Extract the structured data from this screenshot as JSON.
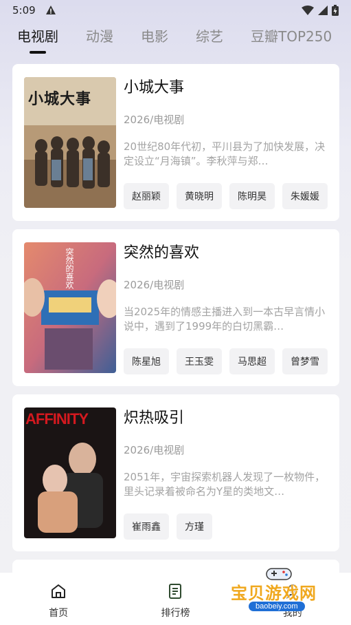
{
  "status_bar": {
    "time": "5:09"
  },
  "tabs": [
    {
      "label": "电视剧",
      "active": true
    },
    {
      "label": "动漫",
      "active": false
    },
    {
      "label": "电影",
      "active": false
    },
    {
      "label": "综艺",
      "active": false
    },
    {
      "label": "豆瓣TOP250",
      "active": false
    }
  ],
  "items": [
    {
      "title": "小城大事",
      "poster_text": "小城大事",
      "meta": "2026/电视剧",
      "desc": "20世纪80年代初，平川县为了加快发展，决定设立“月海镇”。李秋萍与郑…",
      "actors": [
        "赵丽颖",
        "黄晓明",
        "陈明昊",
        "朱媛媛"
      ]
    },
    {
      "title": "突然的喜欢",
      "poster_text": "突然的喜欢",
      "meta": "2026/电视剧",
      "desc": "当2025年的情感主播进入到一本古早言情小说中，遇到了1999年的白切黑霸…",
      "actors": [
        "陈星旭",
        "王玉雯",
        "马思超",
        "曾梦雪"
      ]
    },
    {
      "title": "炽热吸引",
      "poster_text": "AFFINITY",
      "meta": "2026/电视剧",
      "desc": "2051年，宇宙探索机器人发现了一枚物件，里头记录着被命名为Y星的类地文…",
      "actors": [
        "崔雨鑫",
        "方瑾"
      ]
    }
  ],
  "bottom_nav": [
    {
      "label": "首页",
      "icon": "home-icon"
    },
    {
      "label": "排行榜",
      "icon": "ranking-icon"
    },
    {
      "label": "我的",
      "icon": "profile-icon"
    }
  ],
  "watermark": {
    "text": "宝贝游戏网",
    "url": "baobeiy.com"
  }
}
